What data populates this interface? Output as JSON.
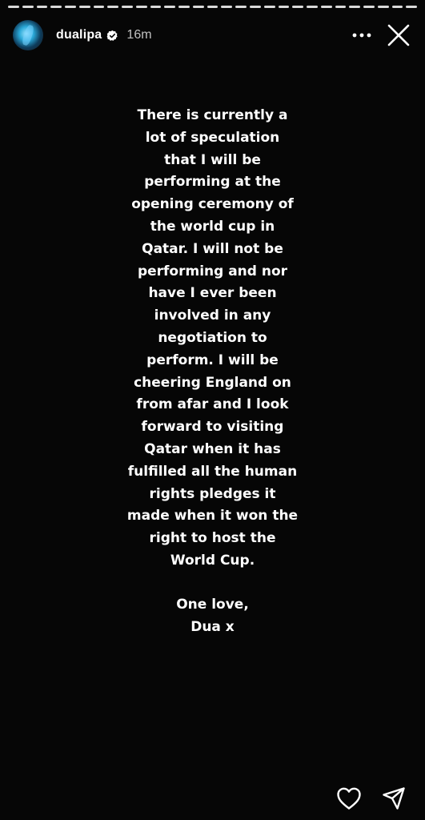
{
  "story": {
    "progress_segments": 29,
    "active_segments": 29,
    "user": {
      "username": "dualipa",
      "verified": true,
      "posted_ago": "16m",
      "avatar_icon": "avatar-image"
    },
    "header_actions": {
      "more_icon": "more-horizontal-icon",
      "close_icon": "close-icon"
    },
    "statement_lines": [
      "There is currently a",
      "lot of speculation",
      "that I will be",
      "performing at the",
      "opening ceremony of",
      "the world cup in",
      "Qatar. I will not be",
      "performing and nor",
      "have I ever been",
      "involved in any",
      "negotiation to",
      "perform. I will be",
      "cheering England on",
      "from afar and I look",
      "forward to visiting",
      "Qatar when it has",
      "fulfilled all the human",
      "rights pledges it",
      "made when it won the",
      "right to host the",
      "World Cup."
    ],
    "signoff_line1": "One love,",
    "signoff_line2": "Dua x",
    "footer_actions": {
      "like_icon": "heart-icon",
      "share_icon": "send-icon"
    },
    "colors": {
      "background": "#060606",
      "text": "#ffffff",
      "verified_badge": "#ffffff"
    }
  }
}
